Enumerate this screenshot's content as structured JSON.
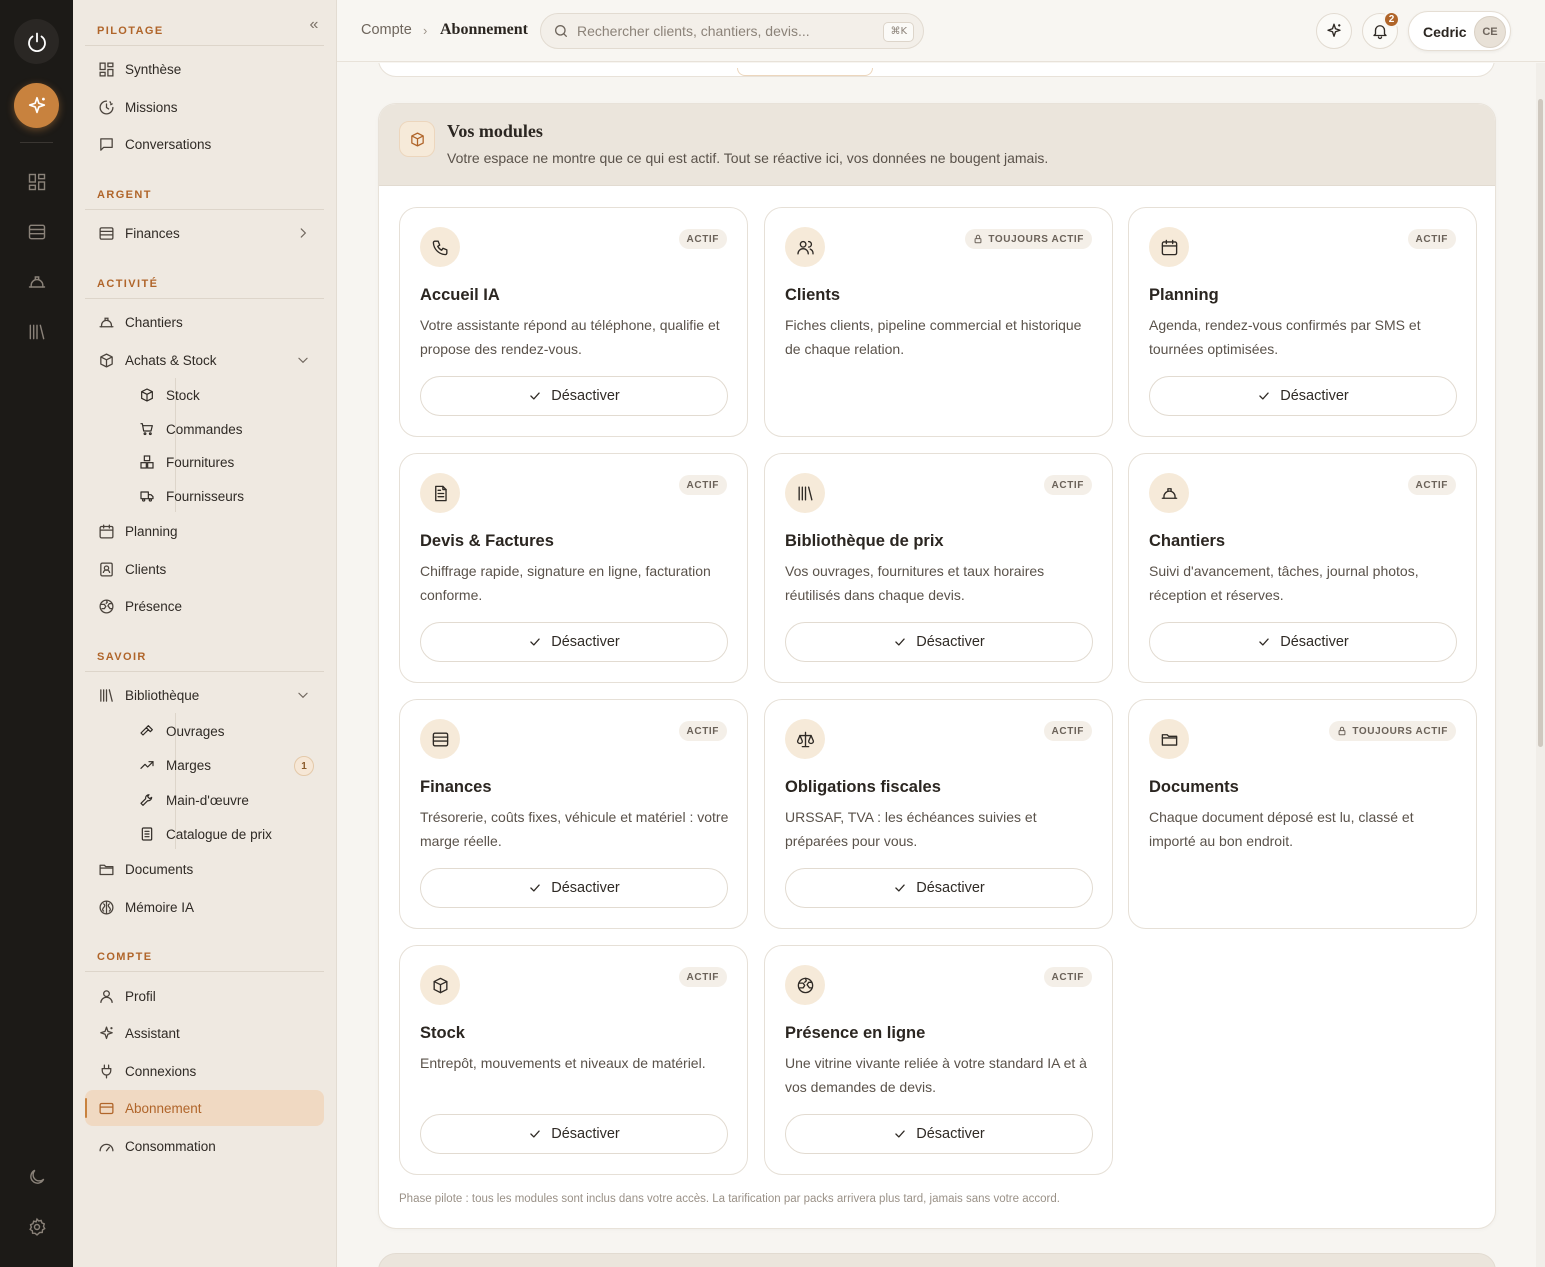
{
  "colors": {
    "accent": "#c8823e",
    "accent_text": "#b0652a",
    "rail_bg": "#1c1a17",
    "sidebar_bg": "#efe9e1"
  },
  "rail": {
    "items": [
      "power-icon",
      "sparkle-icon",
      "grid-icon",
      "wallet-icon",
      "helmet-icon",
      "library-icon"
    ],
    "bottom": [
      "moon-icon",
      "gear-icon"
    ]
  },
  "sidebar": {
    "sections": {
      "pilotage": "PILOTAGE",
      "argent": "ARGENT",
      "activite": "ACTIVITÉ",
      "savoir": "SAVOIR",
      "compte": "COMPTE"
    },
    "items": {
      "synthese": "Synthèse",
      "missions": "Missions",
      "conversations": "Conversations",
      "finances": "Finances",
      "chantiers": "Chantiers",
      "achats_stock": "Achats & Stock",
      "stock": "Stock",
      "commandes": "Commandes",
      "fournitures": "Fournitures",
      "fournisseurs": "Fournisseurs",
      "planning": "Planning",
      "clients": "Clients",
      "presence": "Présence",
      "bibliotheque": "Bibliothèque",
      "ouvrages": "Ouvrages",
      "marges": "Marges",
      "marges_badge": "1",
      "main_oeuvre": "Main-d'œuvre",
      "catalogue": "Catalogue de prix",
      "documents": "Documents",
      "memoire": "Mémoire IA",
      "profil": "Profil",
      "assistant": "Assistant",
      "connexions": "Connexions",
      "abonnement": "Abonnement",
      "consommation": "Consommation"
    }
  },
  "topbar": {
    "breadcrumb": [
      "Compte",
      "Abonnement"
    ],
    "search_placeholder": "Rechercher clients, chantiers, devis...",
    "search_shortcut": "⌘K",
    "notifications": "2",
    "user_name": "Cedric",
    "user_initials": "CE"
  },
  "modules": {
    "title": "Vos modules",
    "subtitle": "Votre espace ne montre que ce qui est actif. Tout se réactive ici, vos données ne bougent jamais.",
    "footnote": "Phase pilote : tous les modules sont inclus dans votre accès. La tarification par packs arrivera plus tard, jamais sans votre accord.",
    "button_label": "Désactiver",
    "cards": [
      {
        "icon": "phone-icon",
        "status": "ACTIF",
        "title": "Accueil IA",
        "desc": "Votre assistante répond au téléphone, qualifie et propose des rendez-vous.",
        "button": true
      },
      {
        "icon": "users-icon",
        "status": "TOUJOURS ACTIF",
        "title": "Clients",
        "desc": "Fiches clients, pipeline commercial et historique de chaque relation.",
        "button": false
      },
      {
        "icon": "calendar-icon",
        "status": "ACTIF",
        "title": "Planning",
        "desc": "Agenda, rendez-vous confirmés par SMS et tournées optimisées.",
        "button": true
      },
      {
        "icon": "document-icon",
        "status": "ACTIF",
        "title": "Devis & Factures",
        "desc": "Chiffrage rapide, signature en ligne, facturation conforme.",
        "button": true
      },
      {
        "icon": "library-icon",
        "status": "ACTIF",
        "title": "Bibliothèque de prix",
        "desc": "Vos ouvrages, fournitures et taux horaires réutilisés dans chaque devis.",
        "button": true
      },
      {
        "icon": "helmet-icon",
        "status": "ACTIF",
        "title": "Chantiers",
        "desc": "Suivi d'avancement, tâches, journal photos, réception et réserves.",
        "button": true
      },
      {
        "icon": "wallet-icon",
        "status": "ACTIF",
        "title": "Finances",
        "desc": "Trésorerie, coûts fixes, véhicule et matériel : votre marge réelle.",
        "button": true
      },
      {
        "icon": "scale-icon",
        "status": "ACTIF",
        "title": "Obligations fiscales",
        "desc": "URSSAF, TVA : les échéances suivies et préparées pour vous.",
        "button": true
      },
      {
        "icon": "folder-icon",
        "status": "TOUJOURS ACTIF",
        "title": "Documents",
        "desc": "Chaque document déposé est lu, classé et importé au bon endroit.",
        "button": false
      },
      {
        "icon": "box-icon",
        "status": "ACTIF",
        "title": "Stock",
        "desc": "Entrepôt, mouvements et niveaux de matériel.",
        "button": true
      },
      {
        "icon": "globe-icon",
        "status": "ACTIF",
        "title": "Présence en ligne",
        "desc": "Une vitrine vivante reliée à votre standard IA et à vos demandes de devis.",
        "button": true
      }
    ]
  }
}
